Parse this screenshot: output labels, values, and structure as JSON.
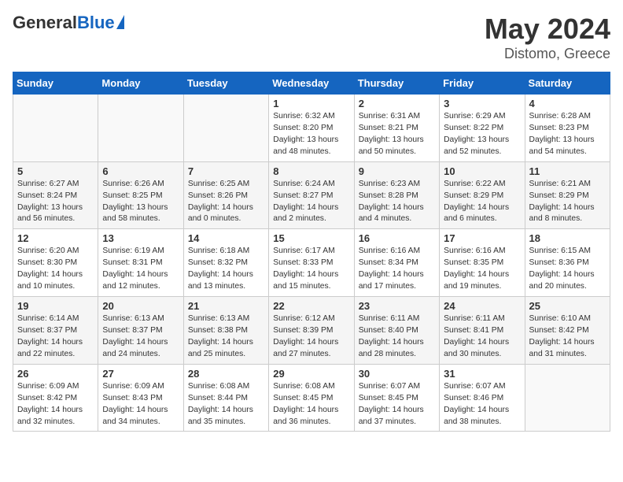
{
  "header": {
    "logo_general": "General",
    "logo_blue": "Blue",
    "month_year": "May 2024",
    "location": "Distomo, Greece"
  },
  "days_of_week": [
    "Sunday",
    "Monday",
    "Tuesday",
    "Wednesday",
    "Thursday",
    "Friday",
    "Saturday"
  ],
  "weeks": [
    [
      {
        "day": "",
        "content": ""
      },
      {
        "day": "",
        "content": ""
      },
      {
        "day": "",
        "content": ""
      },
      {
        "day": "1",
        "content": "Sunrise: 6:32 AM\nSunset: 8:20 PM\nDaylight: 13 hours\nand 48 minutes."
      },
      {
        "day": "2",
        "content": "Sunrise: 6:31 AM\nSunset: 8:21 PM\nDaylight: 13 hours\nand 50 minutes."
      },
      {
        "day": "3",
        "content": "Sunrise: 6:29 AM\nSunset: 8:22 PM\nDaylight: 13 hours\nand 52 minutes."
      },
      {
        "day": "4",
        "content": "Sunrise: 6:28 AM\nSunset: 8:23 PM\nDaylight: 13 hours\nand 54 minutes."
      }
    ],
    [
      {
        "day": "5",
        "content": "Sunrise: 6:27 AM\nSunset: 8:24 PM\nDaylight: 13 hours\nand 56 minutes."
      },
      {
        "day": "6",
        "content": "Sunrise: 6:26 AM\nSunset: 8:25 PM\nDaylight: 13 hours\nand 58 minutes."
      },
      {
        "day": "7",
        "content": "Sunrise: 6:25 AM\nSunset: 8:26 PM\nDaylight: 14 hours\nand 0 minutes."
      },
      {
        "day": "8",
        "content": "Sunrise: 6:24 AM\nSunset: 8:27 PM\nDaylight: 14 hours\nand 2 minutes."
      },
      {
        "day": "9",
        "content": "Sunrise: 6:23 AM\nSunset: 8:28 PM\nDaylight: 14 hours\nand 4 minutes."
      },
      {
        "day": "10",
        "content": "Sunrise: 6:22 AM\nSunset: 8:29 PM\nDaylight: 14 hours\nand 6 minutes."
      },
      {
        "day": "11",
        "content": "Sunrise: 6:21 AM\nSunset: 8:29 PM\nDaylight: 14 hours\nand 8 minutes."
      }
    ],
    [
      {
        "day": "12",
        "content": "Sunrise: 6:20 AM\nSunset: 8:30 PM\nDaylight: 14 hours\nand 10 minutes."
      },
      {
        "day": "13",
        "content": "Sunrise: 6:19 AM\nSunset: 8:31 PM\nDaylight: 14 hours\nand 12 minutes."
      },
      {
        "day": "14",
        "content": "Sunrise: 6:18 AM\nSunset: 8:32 PM\nDaylight: 14 hours\nand 13 minutes."
      },
      {
        "day": "15",
        "content": "Sunrise: 6:17 AM\nSunset: 8:33 PM\nDaylight: 14 hours\nand 15 minutes."
      },
      {
        "day": "16",
        "content": "Sunrise: 6:16 AM\nSunset: 8:34 PM\nDaylight: 14 hours\nand 17 minutes."
      },
      {
        "day": "17",
        "content": "Sunrise: 6:16 AM\nSunset: 8:35 PM\nDaylight: 14 hours\nand 19 minutes."
      },
      {
        "day": "18",
        "content": "Sunrise: 6:15 AM\nSunset: 8:36 PM\nDaylight: 14 hours\nand 20 minutes."
      }
    ],
    [
      {
        "day": "19",
        "content": "Sunrise: 6:14 AM\nSunset: 8:37 PM\nDaylight: 14 hours\nand 22 minutes."
      },
      {
        "day": "20",
        "content": "Sunrise: 6:13 AM\nSunset: 8:37 PM\nDaylight: 14 hours\nand 24 minutes."
      },
      {
        "day": "21",
        "content": "Sunrise: 6:13 AM\nSunset: 8:38 PM\nDaylight: 14 hours\nand 25 minutes."
      },
      {
        "day": "22",
        "content": "Sunrise: 6:12 AM\nSunset: 8:39 PM\nDaylight: 14 hours\nand 27 minutes."
      },
      {
        "day": "23",
        "content": "Sunrise: 6:11 AM\nSunset: 8:40 PM\nDaylight: 14 hours\nand 28 minutes."
      },
      {
        "day": "24",
        "content": "Sunrise: 6:11 AM\nSunset: 8:41 PM\nDaylight: 14 hours\nand 30 minutes."
      },
      {
        "day": "25",
        "content": "Sunrise: 6:10 AM\nSunset: 8:42 PM\nDaylight: 14 hours\nand 31 minutes."
      }
    ],
    [
      {
        "day": "26",
        "content": "Sunrise: 6:09 AM\nSunset: 8:42 PM\nDaylight: 14 hours\nand 32 minutes."
      },
      {
        "day": "27",
        "content": "Sunrise: 6:09 AM\nSunset: 8:43 PM\nDaylight: 14 hours\nand 34 minutes."
      },
      {
        "day": "28",
        "content": "Sunrise: 6:08 AM\nSunset: 8:44 PM\nDaylight: 14 hours\nand 35 minutes."
      },
      {
        "day": "29",
        "content": "Sunrise: 6:08 AM\nSunset: 8:45 PM\nDaylight: 14 hours\nand 36 minutes."
      },
      {
        "day": "30",
        "content": "Sunrise: 6:07 AM\nSunset: 8:45 PM\nDaylight: 14 hours\nand 37 minutes."
      },
      {
        "day": "31",
        "content": "Sunrise: 6:07 AM\nSunset: 8:46 PM\nDaylight: 14 hours\nand 38 minutes."
      },
      {
        "day": "",
        "content": ""
      }
    ]
  ]
}
